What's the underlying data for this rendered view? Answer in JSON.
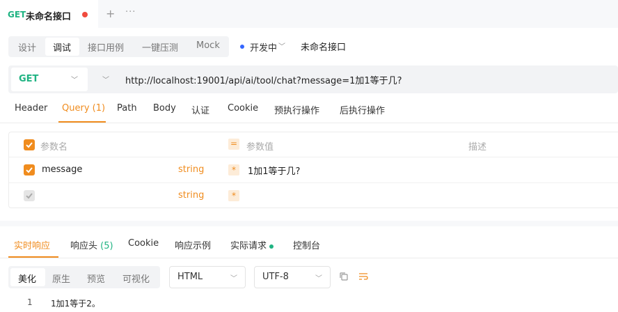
{
  "tab": {
    "method": "GET",
    "name": "未命名接口",
    "plus": "+",
    "more": "···"
  },
  "toolbar": {
    "modes": [
      "设计",
      "调试",
      "接口用例",
      "一键压测",
      "Mock"
    ],
    "active_mode": "调试",
    "env_status": "开发中",
    "api_title": "未命名接口"
  },
  "request": {
    "method": "GET",
    "url": "http://localhost:19001/api/ai/tool/chat?message=1加1等于几?"
  },
  "param_tabs": [
    "Header",
    "Query (1)",
    "Path",
    "Body",
    "认证",
    "Cookie",
    "预执行操作",
    "后执行操作"
  ],
  "params": {
    "headers": {
      "name": "参数名",
      "value": "参数值",
      "desc": "描述"
    },
    "rows": [
      {
        "checked": true,
        "name": "message",
        "type": "string",
        "value": "1加1等于几?"
      },
      {
        "checked": true,
        "name": "",
        "type": "string",
        "value": ""
      }
    ]
  },
  "response": {
    "tabs": {
      "realtime": "实时响应",
      "headers_label": "响应头",
      "headers_count": "(5)",
      "cookie": "Cookie",
      "example": "响应示例",
      "actual": "实际请求",
      "console": "控制台"
    },
    "view_modes": [
      "美化",
      "原生",
      "预览",
      "可视化"
    ],
    "format": "HTML",
    "encoding": "UTF-8",
    "lines": [
      {
        "no": "1",
        "text": "1加1等于2。"
      }
    ]
  },
  "colors": {
    "accent": "#f08c1e",
    "get": "#1fb382",
    "unsaved_dot": "#f04b3e",
    "env_dot": "#3366ff"
  }
}
